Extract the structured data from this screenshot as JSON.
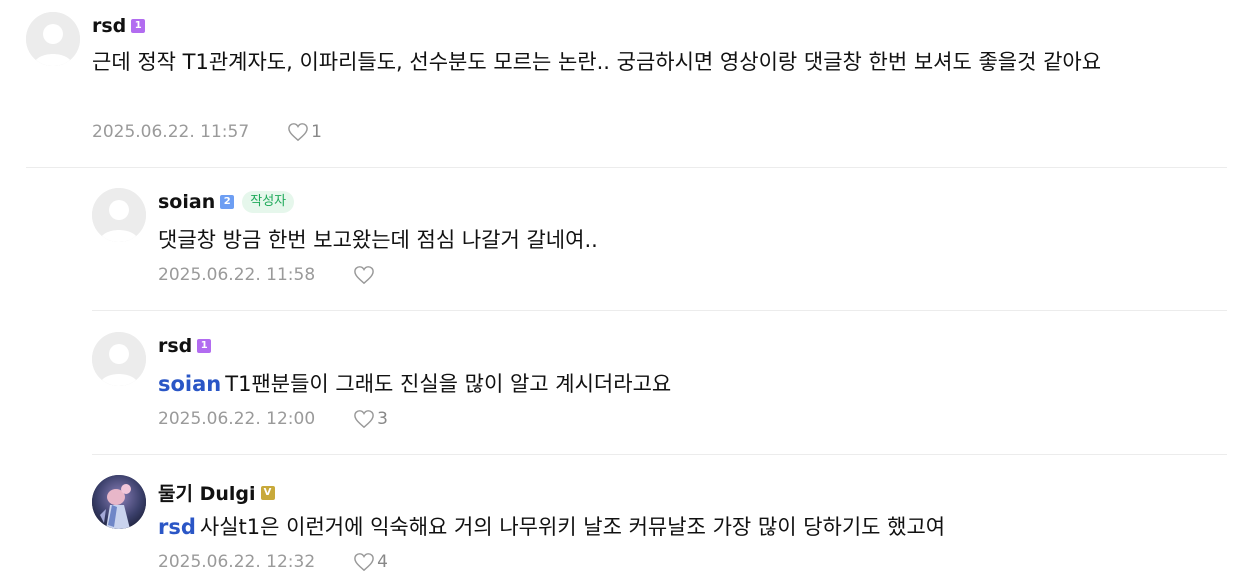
{
  "comments": [
    {
      "nickname": "rsd",
      "grade_icon": "grade-1-badge",
      "grade": "1",
      "grade_color": "#b26cf0",
      "mention": "",
      "text": "근데 정작 T1관계자도, 이파리들도, 선수분도 모르는 논란.. 궁금하시면 영상이랑 댓글창 한번 보셔도 좋을것 같아요",
      "date": "2025.06.22. 11:57",
      "like_count": "1",
      "is_reply": false
    },
    {
      "nickname": "soian",
      "grade_icon": "grade-2-badge",
      "grade": "2",
      "grade_color": "#6d9ef3",
      "writer_badge": "작성자",
      "mention": "",
      "text": "댓글창 방금 한번 보고왔는데 점심 나갈거 갈네여..",
      "date": "2025.06.22. 11:58",
      "like_count": "",
      "is_reply": true
    },
    {
      "nickname": "rsd",
      "grade_icon": "grade-1-badge",
      "grade": "1",
      "grade_color": "#b26cf0",
      "mention": "soian",
      "text": "T1팬분들이 그래도 진실을 많이 알고 계시더라고요",
      "date": "2025.06.22. 12:00",
      "like_count": "3",
      "is_reply": true
    },
    {
      "nickname": "둘기 Dulgi",
      "grade_icon": "grade-v-badge",
      "grade": "V",
      "grade_color": "#c8a93a",
      "mention": "rsd",
      "text": "사실t1은 이런거에 익숙해요 거의 나무위키 날조 커뮤날조 가장 많이 당하기도 했고여",
      "date": "2025.06.22. 12:32",
      "like_count": "4",
      "is_reply": true
    }
  ],
  "icons": {
    "like": "heart-outline-icon",
    "default_avatar": "default-profile-icon"
  }
}
